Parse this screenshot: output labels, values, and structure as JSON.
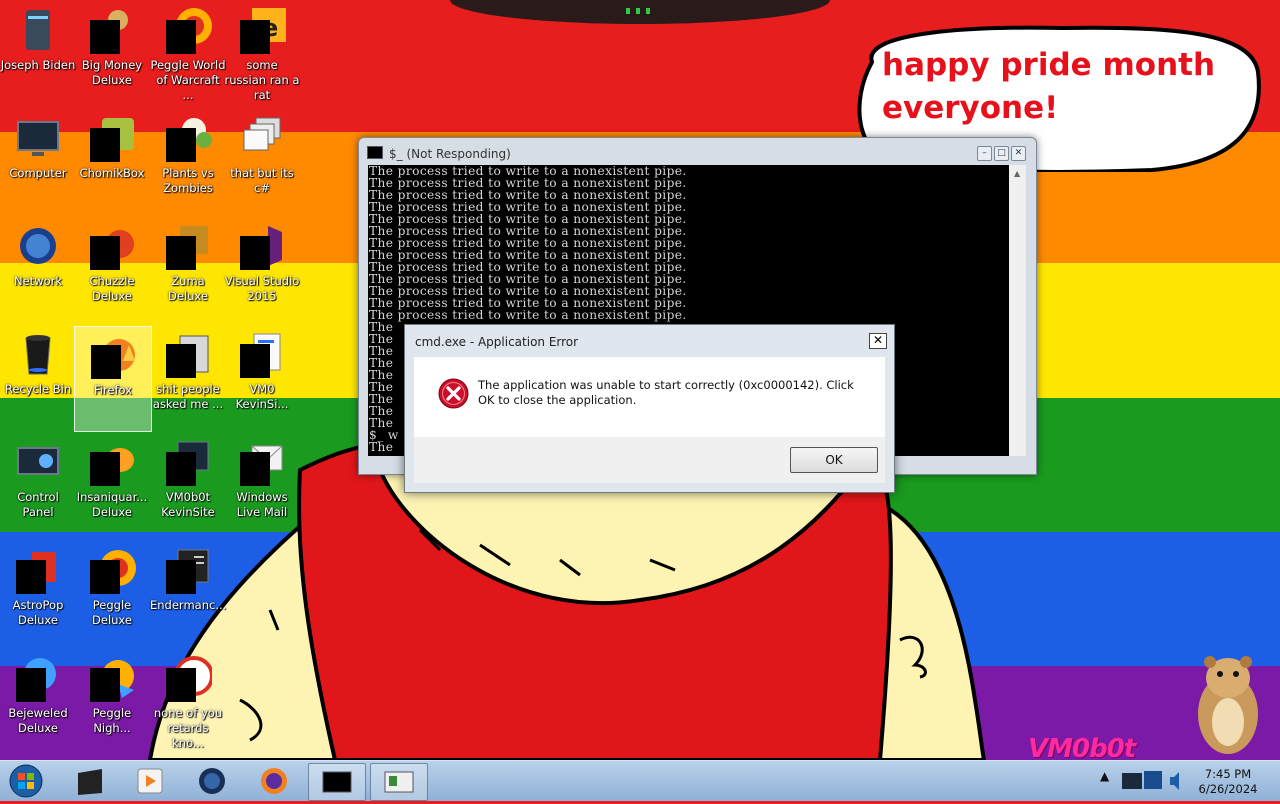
{
  "wallpaper": {
    "speech_text": "happy pride month everyone!",
    "tag_text": "VM0b0t",
    "stripe_colors": [
      "#e81d1d",
      "#ff8a00",
      "#ffe600",
      "#1a9a1f",
      "#1c5fe6",
      "#7a1aa6"
    ]
  },
  "desktop_icons": [
    {
      "label": "Joseph Biden",
      "icon": "tower-icon"
    },
    {
      "label": "Big Money Deluxe",
      "icon": "game-icon"
    },
    {
      "label": "Peggle World of Warcraft ...",
      "icon": "game-icon"
    },
    {
      "label": "some russian ran a rat",
      "icon": "app-icon"
    },
    {
      "label": "Computer",
      "icon": "monitor-icon"
    },
    {
      "label": "ChomikBox",
      "icon": "app-icon"
    },
    {
      "label": "Plants vs Zombies",
      "icon": "game-icon"
    },
    {
      "label": "that but its c#",
      "icon": "windows-stack-icon"
    },
    {
      "label": "Network",
      "icon": "globe-icon"
    },
    {
      "label": "Chuzzle Deluxe",
      "icon": "game-icon"
    },
    {
      "label": "Zuma Deluxe",
      "icon": "game-icon"
    },
    {
      "label": "Visual Studio 2015",
      "icon": "visual-studio-icon"
    },
    {
      "label": "Recycle Bin",
      "icon": "recycle-bin-icon"
    },
    {
      "label": "Firefox",
      "icon": "firefox-icon"
    },
    {
      "label": "shit people asked me ...",
      "icon": "folder-icon"
    },
    {
      "label": "VM0 KevinSi...",
      "icon": "document-icon"
    },
    {
      "label": "Control Panel",
      "icon": "control-panel-icon"
    },
    {
      "label": "Insaniquar... Deluxe",
      "icon": "game-icon"
    },
    {
      "label": "VM0b0t KevinSite",
      "icon": "app-icon"
    },
    {
      "label": "Windows Live Mail",
      "icon": "mail-icon"
    },
    {
      "label": "AstroPop Deluxe",
      "icon": "game-icon"
    },
    {
      "label": "Peggle Deluxe",
      "icon": "game-icon"
    },
    {
      "label": "Endermanc...",
      "icon": "app-icon"
    },
    {
      "label": "Bejeweled Deluxe",
      "icon": "game-icon"
    },
    {
      "label": "Peggle Nigh...",
      "icon": "game-icon"
    },
    {
      "label": "none of you retards kno...",
      "icon": "game-icon"
    }
  ],
  "cmd_window": {
    "title": "$_ (Not Responding)",
    "lines": [
      "The process tried to write to a nonexistent pipe.",
      "The process tried to write to a nonexistent pipe.",
      "The process tried to write to a nonexistent pipe.",
      "The process tried to write to a nonexistent pipe.",
      "The process tried to write to a nonexistent pipe.",
      "The process tried to write to a nonexistent pipe.",
      "The process tried to write to a nonexistent pipe.",
      "The process tried to write to a nonexistent pipe.",
      "The process tried to write to a nonexistent pipe.",
      "The process tried to write to a nonexistent pipe.",
      "The process tried to write to a nonexistent pipe.",
      "The process tried to write to a nonexistent pipe.",
      "The process tried to write to a nonexistent pipe.",
      "The",
      "The",
      "The",
      "The",
      "The",
      "The",
      "The",
      "The",
      "The",
      "$_ w",
      "The"
    ]
  },
  "error_dialog": {
    "title": "cmd.exe - Application Error",
    "message": "The application was unable to start correctly (0xc0000142). Click OK to close the application.",
    "ok_label": "OK",
    "close_label": "✕"
  },
  "taskbar": {
    "time": "7:45 PM",
    "date": "6/26/2024",
    "tray_arrow": "▲"
  }
}
